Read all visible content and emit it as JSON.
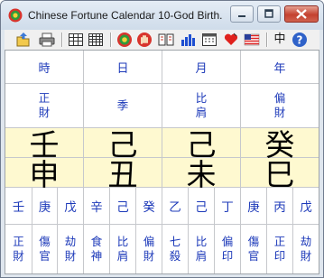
{
  "window": {
    "title": "Chinese Fortune Calendar 10-God Birth..."
  },
  "toolbar": {
    "icons": [
      "open-folder-icon",
      "print-icon",
      "grid-small-icon",
      "grid-large-icon",
      "color-wheel-icon",
      "hand-icon",
      "book-icon",
      "bar-chart-icon",
      "calendar-icon",
      "heart-icon",
      "us-flag-icon",
      "chinese-char-icon",
      "help-icon"
    ],
    "chinese_button_label": "中"
  },
  "pillars": [
    {
      "label": "時",
      "god": "正財",
      "stem": "壬",
      "branch": "申",
      "hidden_stems": [
        "壬",
        "庚",
        "戊"
      ],
      "hidden_gods": [
        "正財",
        "傷官",
        "劫財"
      ]
    },
    {
      "label": "日",
      "god": "季",
      "stem": "己",
      "branch": "丑",
      "hidden_stems": [
        "辛",
        "己",
        "癸"
      ],
      "hidden_gods": [
        "食神",
        "比肩",
        "偏財"
      ]
    },
    {
      "label": "月",
      "god": "比肩",
      "stem": "己",
      "branch": "未",
      "hidden_stems": [
        "乙",
        "己",
        "丁"
      ],
      "hidden_gods": [
        "七殺",
        "比肩",
        "偏印"
      ]
    },
    {
      "label": "年",
      "god": "偏財",
      "stem": "癸",
      "branch": "巳",
      "hidden_stems": [
        "庚",
        "丙",
        "戊"
      ],
      "hidden_gods": [
        "傷官",
        "正印",
        "劫財"
      ]
    }
  ],
  "colors": {
    "highlight_band": "#fef9d0",
    "text_blue": "#1c39b9",
    "text_black": "#000000"
  }
}
